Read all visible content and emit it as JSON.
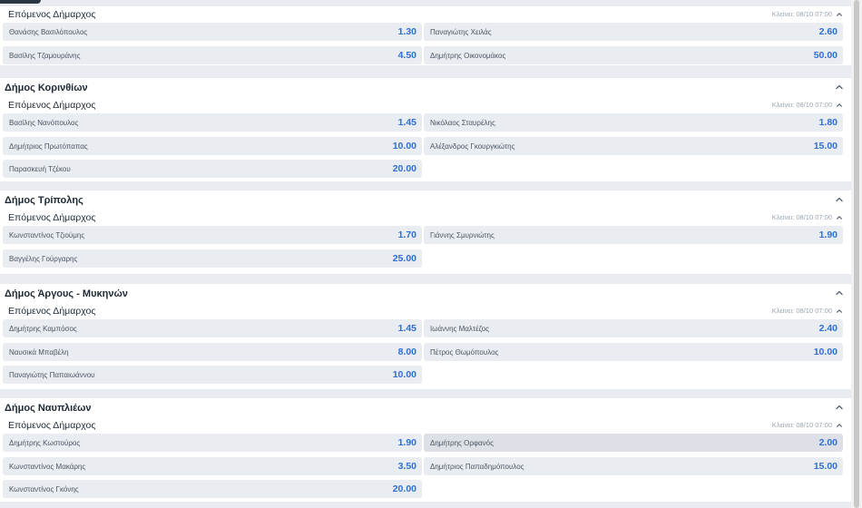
{
  "sections": [
    {
      "title": "",
      "market": "Επόμενος Δήμαρχος",
      "closes": "Κλείνει: 08/10 07:00",
      "selections": [
        {
          "name": "Θανάσης Βασιλόπουλος",
          "odds": "1.30"
        },
        {
          "name": "Παναγιώτης Χειλάς",
          "odds": "2.60"
        },
        {
          "name": "Βασίλης Τζαμουράνης",
          "odds": "4.50"
        },
        {
          "name": "Δημήτρης Οικονομάκος",
          "odds": "50.00"
        }
      ]
    },
    {
      "title": "Δήμος Κορινθίων",
      "market": "Επόμενος Δήμαρχος",
      "closes": "Κλείνει: 08/10 07:00",
      "selections": [
        {
          "name": "Βασίλης Νανόπουλος",
          "odds": "1.45"
        },
        {
          "name": "Νικόλαος Σταυρέλης",
          "odds": "1.80"
        },
        {
          "name": "Δημήτριος Πρωτόπαπας",
          "odds": "10.00"
        },
        {
          "name": "Αλέξανδρος Γκουργκιώτης",
          "odds": "15.00"
        },
        {
          "name": "Παρασκευή Τζέκου",
          "odds": "20.00"
        }
      ]
    },
    {
      "title": "Δήμος Τρίπολης",
      "market": "Επόμενος Δήμαρχος",
      "closes": "Κλείνει: 08/10 07:00",
      "selections": [
        {
          "name": "Κωνσταντίνος Τζιούμης",
          "odds": "1.70"
        },
        {
          "name": "Γιάννης Σμυρνιώτης",
          "odds": "1.90"
        },
        {
          "name": "Βαγγέλης Γούργαρης",
          "odds": "25.00"
        }
      ]
    },
    {
      "title": "Δήμος Άργους - Μυκηνών",
      "market": "Επόμενος Δήμαρχος",
      "closes": "Κλείνει: 08/10 07:00",
      "selections": [
        {
          "name": "Δημήτρης Καμπόσος",
          "odds": "1.45"
        },
        {
          "name": "Ιωάννης Μαλτέζος",
          "odds": "2.40"
        },
        {
          "name": "Ναυσικά Μπαβέλη",
          "odds": "8.00"
        },
        {
          "name": "Πέτρος Θωμόπουλος",
          "odds": "10.00"
        },
        {
          "name": "Παναγιώτης Παπαιωάννου",
          "odds": "10.00"
        }
      ]
    },
    {
      "title": "Δήμος Ναυπλιέων",
      "market": "Επόμενος Δήμαρχος",
      "closes": "Κλείνει: 08/10 07:00",
      "selections": [
        {
          "name": "Δημήτρης Κωστούρος",
          "odds": "1.90"
        },
        {
          "name": "Δημήτρης Ορφανός",
          "odds": "2.00",
          "selected": true
        },
        {
          "name": "Κωνσταντίνος Μακάρης",
          "odds": "3.50"
        },
        {
          "name": "Δημήτριος Παπαδημόπουλος",
          "odds": "15.00"
        },
        {
          "name": "Κωνσταντίνος Γκόνης",
          "odds": "20.00"
        }
      ]
    }
  ],
  "colors": {
    "odds": "#2f6fd1",
    "cell": "#e9ecf0",
    "background": "#e8ebef"
  },
  "icons": {
    "section_toggle": "chevron-up-icon",
    "market_toggle": "chevron-up-icon"
  }
}
